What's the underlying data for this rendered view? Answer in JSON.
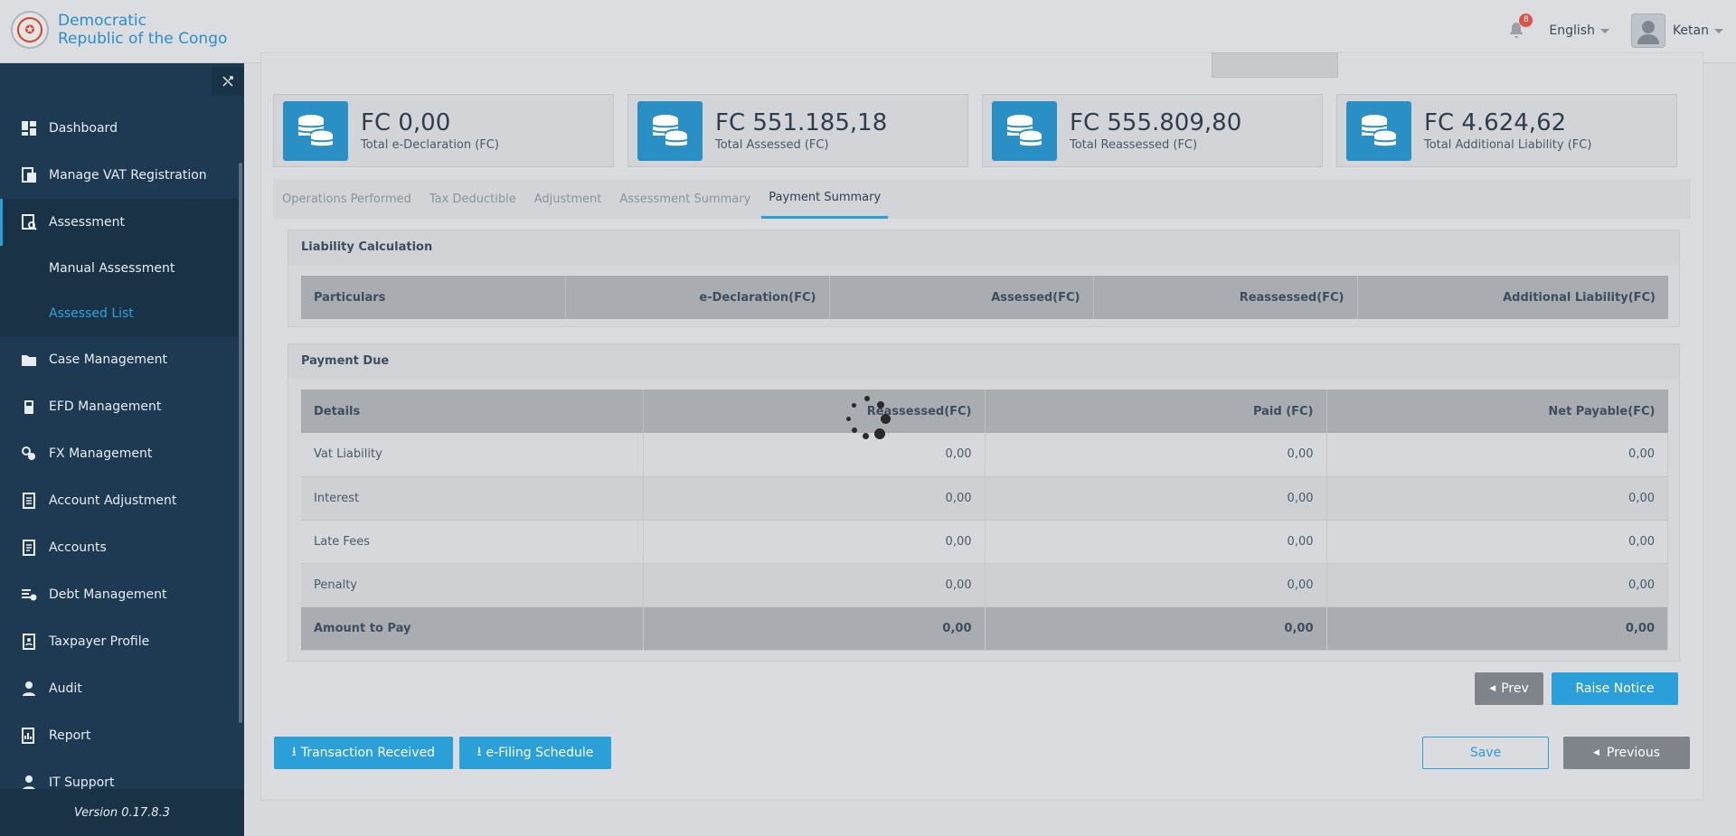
{
  "brand": {
    "line1": "Democratic",
    "line2": "Republic of the Congo"
  },
  "header": {
    "notification_count": "8",
    "language": "English",
    "user_name": "Ketan"
  },
  "sidebar": {
    "items": [
      {
        "label": "Dashboard",
        "icon": "dashboard-icon"
      },
      {
        "label": "Manage VAT Registration",
        "icon": "registration-icon"
      },
      {
        "label": "Assessment",
        "icon": "assessment-icon"
      },
      {
        "label": "Case Management",
        "icon": "folder-icon"
      },
      {
        "label": "EFD Management",
        "icon": "device-icon"
      },
      {
        "label": "FX Management",
        "icon": "exchange-icon"
      },
      {
        "label": "Account Adjustment",
        "icon": "ledger-icon"
      },
      {
        "label": "Accounts",
        "icon": "accounts-icon"
      },
      {
        "label": "Debt Management",
        "icon": "debt-icon"
      },
      {
        "label": "Taxpayer Profile",
        "icon": "profile-icon"
      },
      {
        "label": "Audit",
        "icon": "audit-icon"
      },
      {
        "label": "Report",
        "icon": "report-icon"
      },
      {
        "label": "IT Support",
        "icon": "support-icon"
      }
    ],
    "sub_items": [
      {
        "label": "Manual Assessment"
      },
      {
        "label": "Assessed List"
      }
    ],
    "version": "Version 0.17.8.3"
  },
  "stats": [
    {
      "value": "FC 0,00",
      "label": "Total e-Declaration (FC)"
    },
    {
      "value": "FC 551.185,18",
      "label": "Total Assessed (FC)"
    },
    {
      "value": "FC 555.809,80",
      "label": "Total Reassessed (FC)"
    },
    {
      "value": "FC 4.624,62",
      "label": "Total Additional Liability (FC)"
    }
  ],
  "tabs": [
    "Operations Performed",
    "Tax Deductible",
    "Adjustment",
    "Assessment Summary",
    "Payment Summary"
  ],
  "liability": {
    "title": "Liability Calculation",
    "headers": [
      "Particulars",
      "e-Declaration(FC)",
      "Assessed(FC)",
      "Reassessed(FC)",
      "Additional Liability(FC)"
    ]
  },
  "payment_due": {
    "title": "Payment Due",
    "headers": [
      "Details",
      "Reassessed(FC)",
      "Paid (FC)",
      "Net Payable(FC)"
    ],
    "rows": [
      [
        "Vat Liability",
        "0,00",
        "0,00",
        "0,00"
      ],
      [
        "Interest",
        "0,00",
        "0,00",
        "0,00"
      ],
      [
        "Late Fees",
        "0,00",
        "0,00",
        "0,00"
      ],
      [
        "Penalty",
        "0,00",
        "0,00",
        "0,00"
      ]
    ],
    "total": [
      "Amount to Pay",
      "0,00",
      "0,00",
      "0,00"
    ]
  },
  "buttons": {
    "prev": "Prev",
    "raise_notice": "Raise Notice",
    "transaction_received": "Transaction Received",
    "efiling_schedule": "e-Filing Schedule",
    "save": "Save",
    "previous": "Previous"
  },
  "colors": {
    "accent": "#2a9fd8",
    "sidebar": "#1e3a52"
  }
}
